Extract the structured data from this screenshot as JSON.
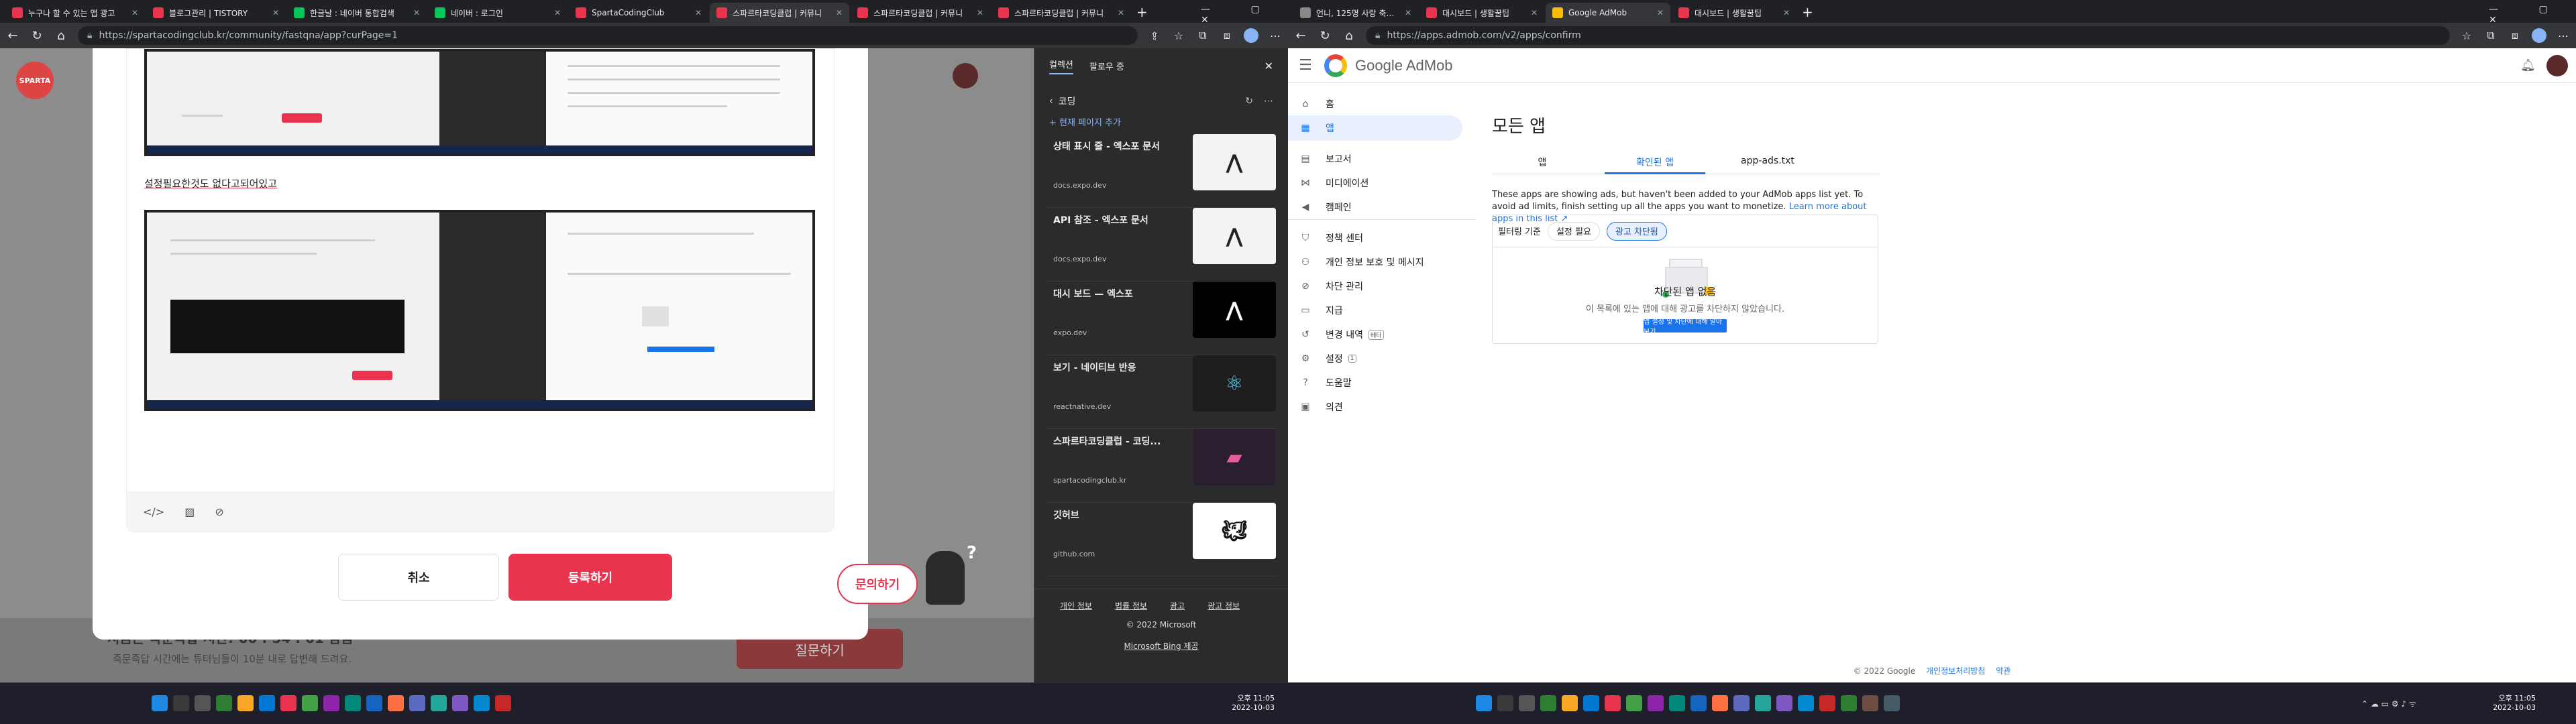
{
  "left_window": {
    "tabs": [
      {
        "title": "누구나 할 수 있는 앱 광고",
        "fav": "#e8344e"
      },
      {
        "title": "블로그관리 | TISTORY",
        "fav": "#e8344e"
      },
      {
        "title": "한글날 : 네이버 통합검색",
        "fav": "#03c75a"
      },
      {
        "title": "네이버 : 로그인",
        "fav": "#03c75a"
      },
      {
        "title": "SpartaCodingClub",
        "fav": "#e8344e"
      },
      {
        "title": "스파르타코딩클럽 | 커뮤니",
        "fav": "#e8344e",
        "active": true
      },
      {
        "title": "스파르타코딩클럽 | 커뮤니",
        "fav": "#e8344e"
      },
      {
        "title": "스파르타코딩클럽 | 커뮤니",
        "fav": "#e8344e"
      }
    ],
    "url": "https://spartacodingclub.kr/community/fastqna/app?curPage=1",
    "sparta": {
      "logo": "SPARTA",
      "caption": "설정필요한것도 없다고되어있고",
      "cancel": "취소",
      "submit": "등록하기",
      "inquiry": "문의하기",
      "mascot_q": "?",
      "bottom_title": "지금은 즉문즉답 시간! 00 : 54 : 01 남음",
      "bottom_sub": "즉문즉답 시간에는 튜터님들이 10분 내로 답변해 드려요.",
      "bottom_btn": "질문하기"
    },
    "collections": {
      "tab_active": "컬렉션",
      "tab_other": "팔로우 중",
      "folder": "코딩",
      "add_current": "+ 현재 페이지 추가",
      "cards": [
        {
          "title": "상태 표시 줄 - 엑스포 문서",
          "domain": "docs.expo.dev",
          "thumb": "expo",
          "bg": "#f3f3f3",
          "fg": "#222"
        },
        {
          "title": "API 참조 - 엑스포 문서",
          "domain": "docs.expo.dev",
          "thumb": "expo",
          "bg": "#f3f3f3",
          "fg": "#222"
        },
        {
          "title": "대시 보드 — 엑스포",
          "domain": "expo.dev",
          "thumb": "expo",
          "bg": "#000000",
          "fg": "#ffffff"
        },
        {
          "title": "보기 - 네이티브 반응",
          "domain": "reactnative.dev",
          "thumb": "react",
          "bg": "#1e1e1e",
          "fg": "#61dafb"
        },
        {
          "title": "스파르타코딩클럽 - 코딩...",
          "domain": "spartacodingclub.kr",
          "thumb": "sparta",
          "bg": "#2a1f2f",
          "fg": "#e85aa0"
        },
        {
          "title": "깃허브",
          "domain": "github.com",
          "thumb": "github",
          "bg": "#ffffff",
          "fg": "#111111"
        }
      ],
      "footer_links": [
        "개인 정보",
        "법률 정보",
        "광고",
        "광고 정보"
      ],
      "copyright": "© 2022 Microsoft",
      "bing": "Microsoft Bing 제공"
    }
  },
  "right_window": {
    "tabs": [
      {
        "title": "언니, 125명 사랑 축구장 참사 조",
        "fav": "#888888"
      },
      {
        "title": "대시보드 | 생활꿀팁",
        "fav": "#e8344e"
      },
      {
        "title": "Google AdMob",
        "fav": "#fbbc04",
        "active": true
      },
      {
        "title": "대시보드 | 생활꿀팁",
        "fav": "#e8344e"
      }
    ],
    "url": "https://apps.admob.com/v2/apps/confirm",
    "admob": {
      "brand": "Google AdMob",
      "nav": [
        {
          "label": "홈",
          "icon": "⌂"
        },
        {
          "label": "앱",
          "icon": "▦",
          "active": true
        },
        {
          "label": "보고서",
          "icon": "▤"
        },
        {
          "label": "미디에이션",
          "icon": "⋈"
        },
        {
          "label": "캠페인",
          "icon": "◀"
        },
        {
          "label": "정책 센터",
          "icon": "⛉"
        },
        {
          "label": "개인 정보 보호 및 메시지",
          "icon": "⚇"
        },
        {
          "label": "차단 관리",
          "icon": "⊘"
        },
        {
          "label": "지급",
          "icon": "▭"
        },
        {
          "label": "변경 내역",
          "icon": "↺",
          "badge": "베타"
        },
        {
          "label": "설정",
          "icon": "⚙",
          "badge": "1"
        },
        {
          "label": "도움말",
          "icon": "?"
        },
        {
          "label": "의견",
          "icon": "▣"
        }
      ],
      "title": "모든 앱",
      "tabs": [
        "앱",
        "확인된 앱",
        "app-ads.txt"
      ],
      "desc": "These apps are showing ads, but haven't been added to your AdMob apps list yet. To avoid ad limits, finish setting up all the apps you want to monetize.",
      "desc_link": "Learn more about apps in this list",
      "filter_label": "필터링 기준",
      "chip1": "설정 필요",
      "chip2": "광고 차단됨",
      "empty_title": "차단된 앱 없음",
      "empty_sub": "이 목록에 있는 앱에 대해 광고를 차단하지 않았습니다.",
      "cta": "앱 설정 및 차단에 대해 알아보기",
      "footer": "© 2022 Google",
      "footer_privacy": "개인정보처리방침",
      "footer_terms": "약관"
    }
  },
  "taskbar_left": {
    "time": "오후 11:05",
    "date": "2022-10-03"
  },
  "taskbar_right": {
    "time": "오후 11:05",
    "date": "2022-10-03"
  }
}
